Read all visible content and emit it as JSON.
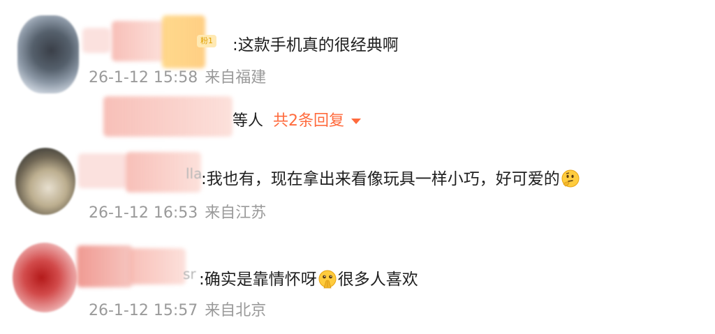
{
  "colors": {
    "text": "#1f1f1f",
    "meta": "#9a9a9a",
    "accent": "#ff6a3c",
    "badge_bg": "#ffe9b3",
    "badge_fg": "#e0a000"
  },
  "comments": [
    {
      "username_tail": "",
      "badge": "粉1",
      "text": ":这款手机真的很经典啊",
      "date": "26-1-12 15:58",
      "location": "来自福建",
      "replies": {
        "who": "等人",
        "more": "共2条回复",
        "icon": "caret-down-icon"
      }
    },
    {
      "username_tail": "lla",
      "text_before": ":我也有，现在拿出来看像玩具一样小巧，好可爱的",
      "emoji": "thinking-face-emoji",
      "date": "26-1-12 16:53",
      "location": "来自江苏"
    },
    {
      "username_tail": "sr",
      "text_before": ":确实是靠情怀呀",
      "emoji": "pleading-hands-emoji",
      "text_after": "很多人喜欢",
      "date": "26-1-12 15:57",
      "location": "来自北京"
    }
  ]
}
